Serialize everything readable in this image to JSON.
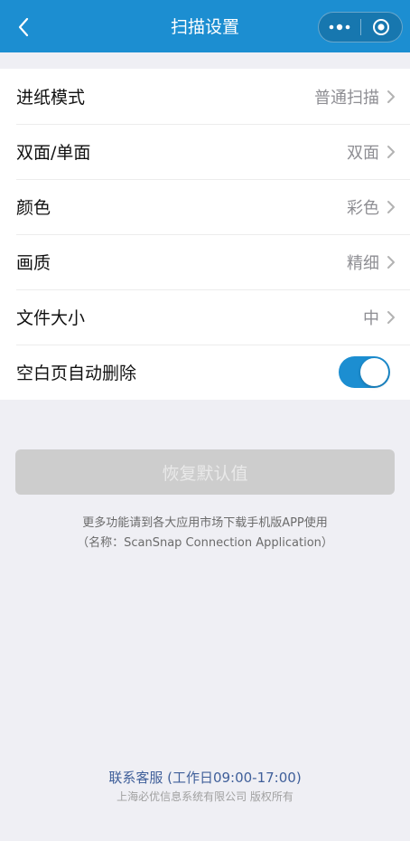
{
  "header": {
    "title": "扫描设置"
  },
  "settings": [
    {
      "label": "进纸模式",
      "value": "普通扫描"
    },
    {
      "label": "双面/单面",
      "value": "双面"
    },
    {
      "label": "颜色",
      "value": "彩色"
    },
    {
      "label": "画质",
      "value": "精细"
    },
    {
      "label": "文件大小",
      "value": "中"
    }
  ],
  "blank_page_delete": {
    "label": "空白页自动删除",
    "enabled": true
  },
  "reset": {
    "label": "恢复默认值"
  },
  "notes": {
    "line1": "更多功能请到各大应用市场下载手机版APP使用",
    "line2": "（名称：ScanSnap Connection Application）"
  },
  "footer": {
    "contact": "联系客服 (工作日09:00-17:00)",
    "copyright": "上海必优信息系统有限公司 版权所有"
  },
  "colors": {
    "accent": "#1c8ed1"
  }
}
